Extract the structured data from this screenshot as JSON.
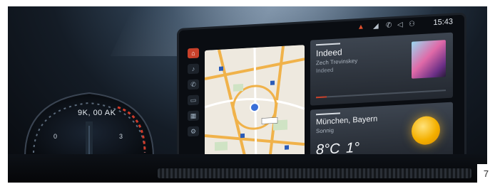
{
  "cluster": {
    "speed": "9K, 00 AK"
  },
  "status": {
    "time": "15:43"
  },
  "nav": {
    "items": [
      "nav",
      "media",
      "phone",
      "car",
      "apps",
      "settings"
    ],
    "active_index": 0
  },
  "media": {
    "title": "Indeed",
    "artist": "Zech Trevinskey",
    "album": "Indeed",
    "progress": 0.08
  },
  "weather": {
    "location": "München, Bayern",
    "condition": "Sonnig",
    "temp_high": "8°C",
    "temp_low": "1°"
  },
  "page_number": "7",
  "colors": {
    "accent": "#c8402a",
    "sun": "#f4b000"
  }
}
